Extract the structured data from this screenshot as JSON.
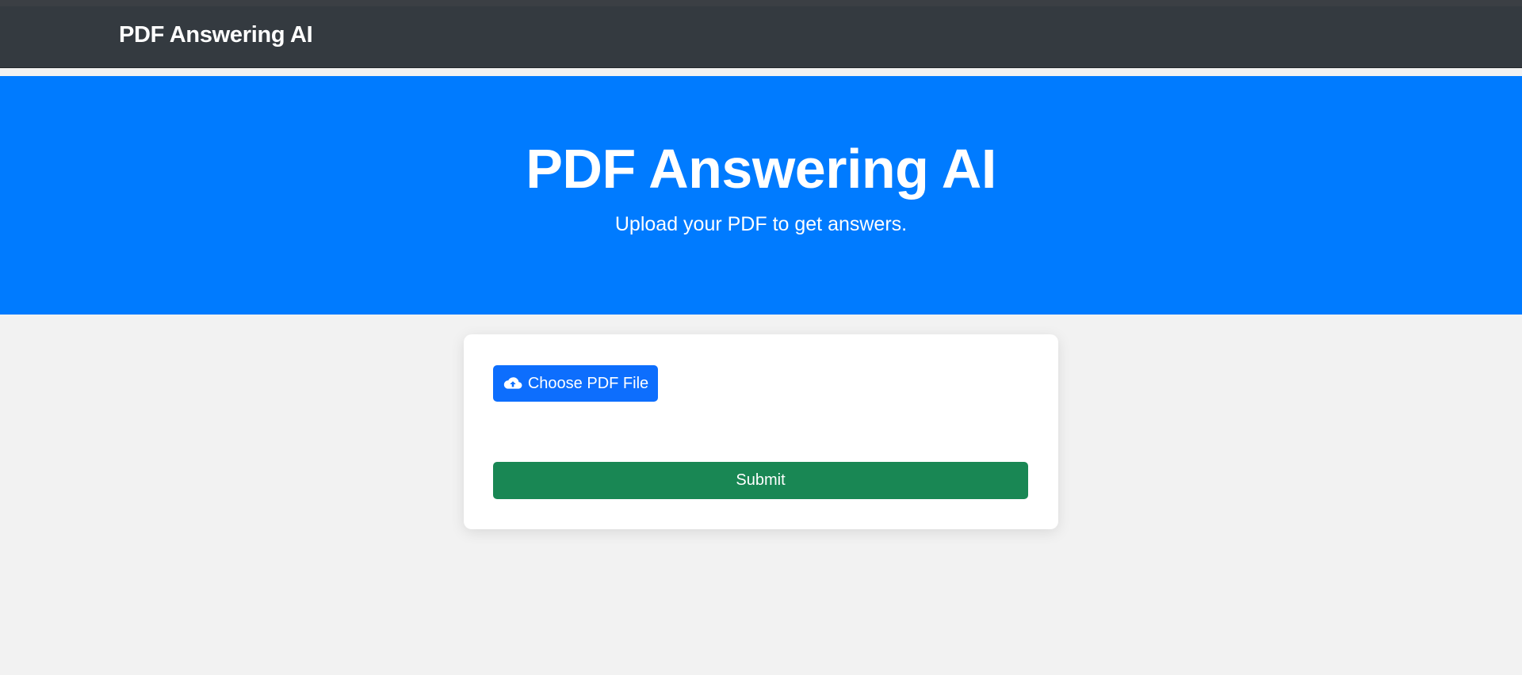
{
  "navbar": {
    "brand": "PDF Answering AI"
  },
  "hero": {
    "title": "PDF Answering AI",
    "subtitle": "Upload your PDF to get answers."
  },
  "form": {
    "choose_label": "Choose PDF File",
    "choose_icon": "cloud-upload-icon",
    "submit_label": "Submit"
  },
  "colors": {
    "navbar_bg": "#343a40",
    "hero_bg": "#007bff",
    "primary_button": "#0d6efd",
    "submit_button": "#198754",
    "page_bg": "#f2f2f2"
  }
}
